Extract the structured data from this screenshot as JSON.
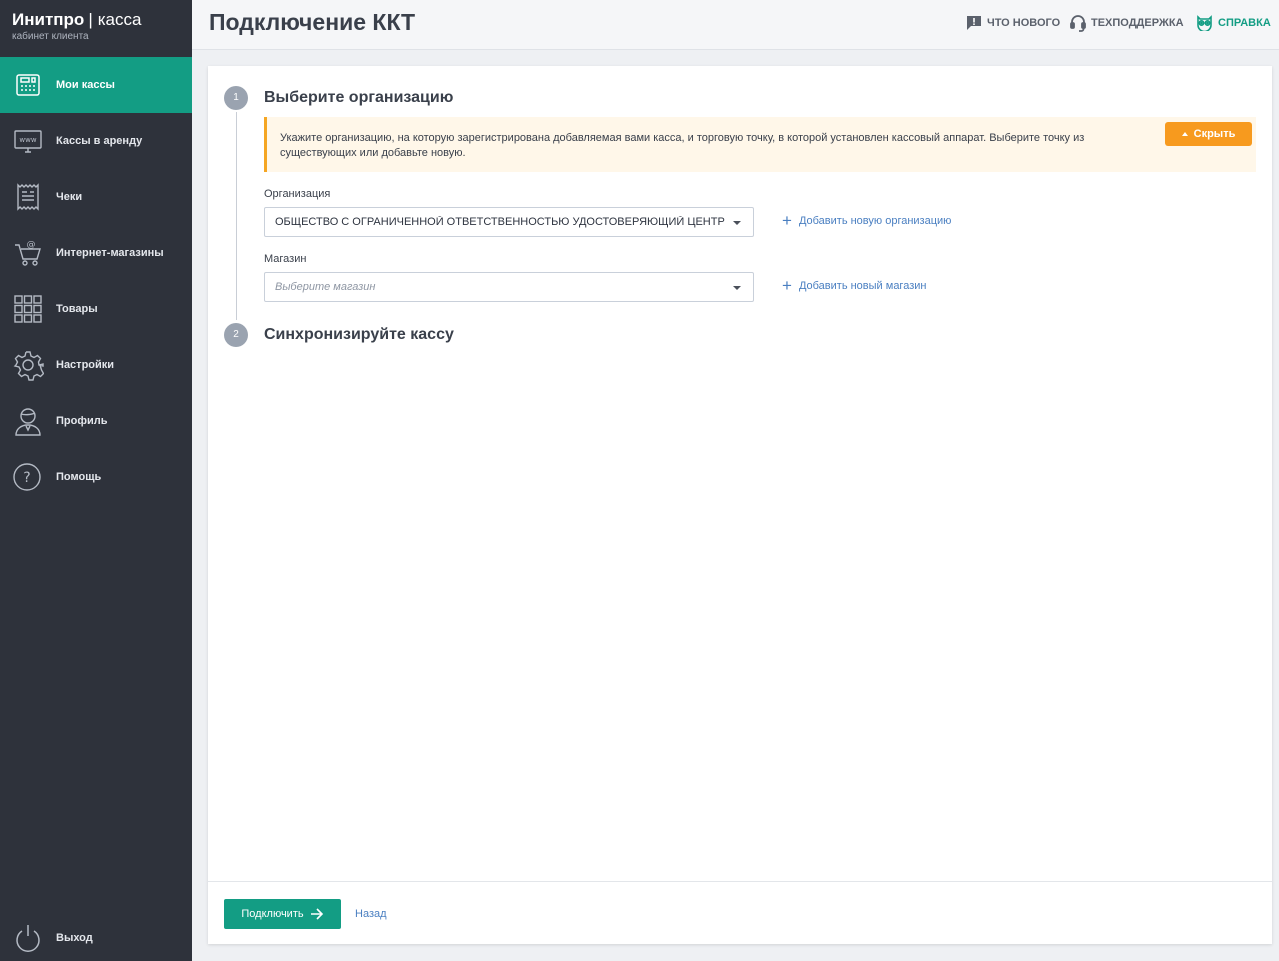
{
  "brand": {
    "name": "Инитпро",
    "separator": "|",
    "product": "касса",
    "subtitle": "кабинет клиента"
  },
  "sidebar": {
    "items": [
      {
        "label": "Мои кассы",
        "icon": "cash-register-icon",
        "active": true
      },
      {
        "label": "Кассы в аренду",
        "icon": "www-monitor-icon"
      },
      {
        "label": "Чеки",
        "icon": "receipt-icon"
      },
      {
        "label": "Интернет-магазины",
        "icon": "shopping-cart-icon"
      },
      {
        "label": "Товары",
        "icon": "grid-icon"
      },
      {
        "label": "Настройки",
        "icon": "gear-icon"
      },
      {
        "label": "Профиль",
        "icon": "user-icon"
      },
      {
        "label": "Помощь",
        "icon": "help-icon"
      }
    ],
    "logout": {
      "label": "Выход",
      "icon": "power-icon"
    }
  },
  "header": {
    "title": "Подключение ККТ",
    "links": {
      "whats_new": {
        "label": "ЧТО НОВОГО",
        "icon": "chat-alert-icon"
      },
      "support": {
        "label": "ТЕХПОДДЕРЖКА",
        "icon": "headset-icon"
      },
      "help": {
        "label": "СПРАВКА",
        "icon": "owl-icon"
      }
    }
  },
  "steps": [
    {
      "number": "1",
      "title": "Выберите организацию"
    },
    {
      "number": "2",
      "title": "Синхронизируйте кассу"
    }
  ],
  "notice": {
    "text": "Укажите организацию, на которую зарегистрирована добавляемая вами касса, и торговую точку, в которой установлен кассовый аппарат. Выберите точку из существующих или добавьте новую.",
    "hide_button": "Скрыть"
  },
  "form": {
    "organization": {
      "label": "Организация",
      "value": "ОБЩЕСТВО С ОГРАНИЧЕННОЙ ОТВЕТСТВЕННОСТЬЮ УДОСТОВЕРЯЮЩИЙ ЦЕНТР",
      "add_link": "Добавить новую организацию"
    },
    "shop": {
      "label": "Магазин",
      "placeholder": "Выберите магазин",
      "add_link": "Добавить новый магазин"
    }
  },
  "footer": {
    "connect_button": "Подключить",
    "back_link": "Назад"
  },
  "colors": {
    "sidebar_bg": "#2e323b",
    "accent": "#139d84",
    "warning": "#f79a1e",
    "link": "#4a7fc1"
  }
}
